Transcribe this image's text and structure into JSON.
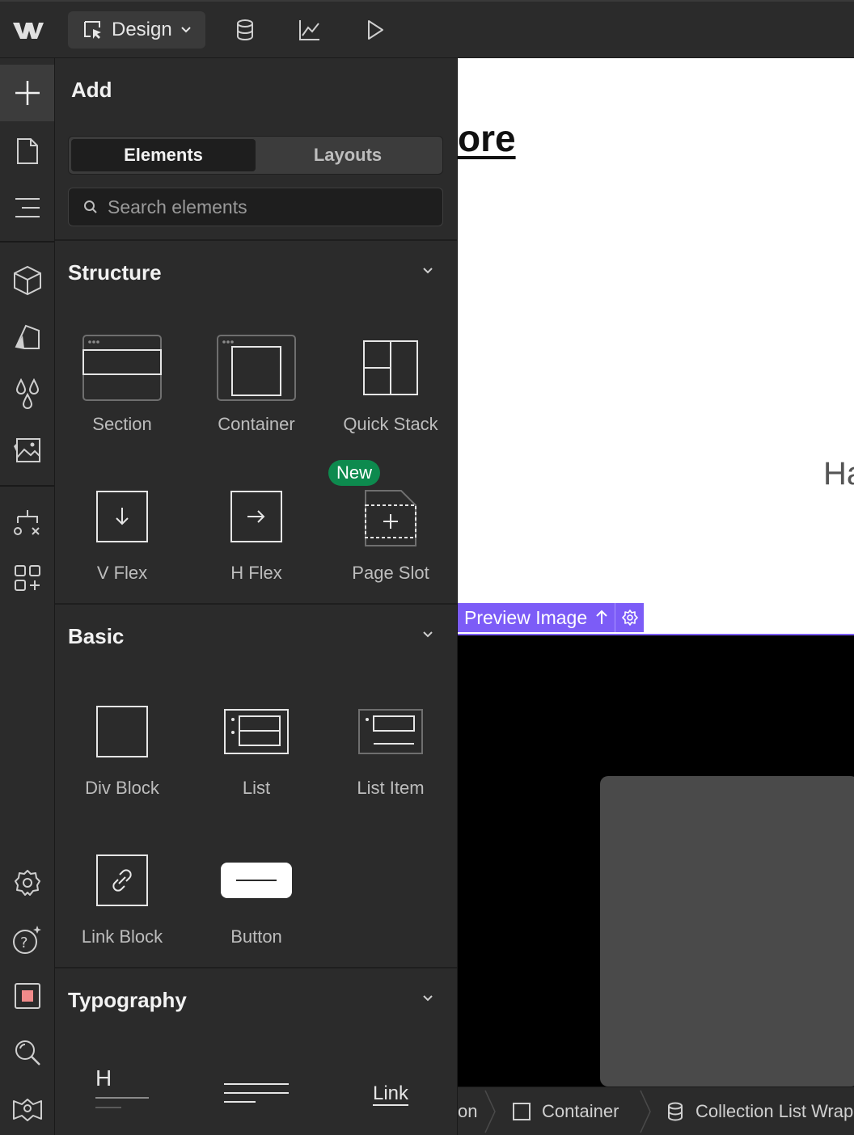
{
  "topbar": {
    "mode_label": "Design",
    "icons": [
      "webflow-logo-icon",
      "cms-database-icon",
      "analytics-chart-icon",
      "preview-play-icon"
    ]
  },
  "rail": {
    "icons": [
      "add-plus-icon",
      "pages-icon",
      "navigator-icon",
      "components-cube-icon",
      "styles-icon",
      "variables-drops-icon",
      "assets-image-icon",
      "logic-flow-icon",
      "apps-icon",
      "settings-gear-icon",
      "help-icon",
      "record-icon",
      "search-icon",
      "community-icon"
    ]
  },
  "panel": {
    "title": "Add",
    "tabs": [
      {
        "label": "Elements",
        "active": true
      },
      {
        "label": "Layouts",
        "active": false
      }
    ],
    "search_placeholder": "Search elements",
    "sections": {
      "structure": {
        "label": "Structure",
        "items": [
          "Section",
          "Container",
          "Quick Stack",
          "V Flex",
          "H Flex",
          "Page Slot"
        ],
        "new_badge": "New"
      },
      "basic": {
        "label": "Basic",
        "items": [
          "Div Block",
          "List",
          "List Item",
          "Link Block",
          "Button"
        ]
      },
      "typography": {
        "label": "Typography",
        "link_sample": "Link",
        "heading_sample": "H"
      }
    }
  },
  "canvas": {
    "heading_fragment": "ore",
    "text_fragment": "Ha",
    "selected_label": "Preview Image"
  },
  "breadcrumbs": {
    "items": [
      "on",
      "Container",
      "Collection List Wrap"
    ]
  },
  "colors": {
    "accent": "#7c5cf7",
    "new_badge": "#0d8a4e"
  }
}
